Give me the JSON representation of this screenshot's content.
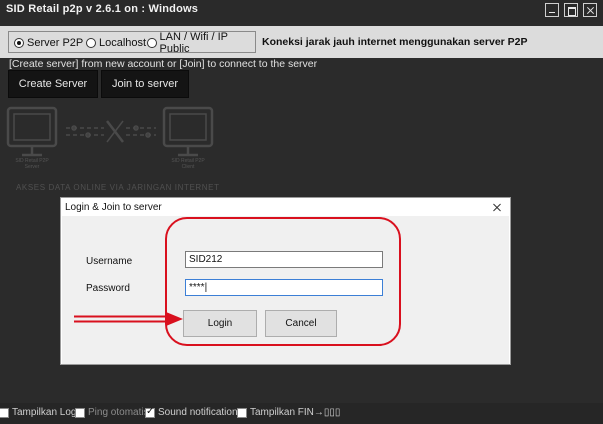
{
  "window": {
    "title": "SID Retail p2p v 2.6.1 on : Windows"
  },
  "mode": {
    "options": [
      "Server P2P",
      "Localhost",
      "LAN / Wifi / IP Public"
    ],
    "selected": "Server P2P",
    "description": "Koneksi jarak jauh internet menggunakan server P2P"
  },
  "hint": "[Create server] from new account or [Join] to connect to the server",
  "toolbar": {
    "create_label": "Create Server",
    "join_label": "Join to server"
  },
  "illustration": {
    "server_label_1": "SID Retail P2P",
    "server_label_2": "Server",
    "client_label_1": "SID Retail P2P",
    "client_label_2": "Client",
    "caption": "AKSES DATA ONLINE VIA JARINGAN INTERNET"
  },
  "dialog": {
    "title": "Login & Join to server",
    "username_label": "Username",
    "username_value": "SID212",
    "password_label": "Password",
    "password_value": "****|",
    "login_label": "Login",
    "cancel_label": "Cancel"
  },
  "statusbar": {
    "items": [
      {
        "label": "Tampilkan Log",
        "checked": false
      },
      {
        "label": "Ping otomatis",
        "checked": false
      },
      {
        "label": "Sound notification",
        "checked": true
      },
      {
        "label": "Tampilkan FIN→",
        "checked": false
      }
    ],
    "trailing": "▯▯▯"
  },
  "colors": {
    "background": "#2b2b2b",
    "modebar": "#dcdcdc",
    "highlight": "#d9101e",
    "dark_button": "#141414"
  },
  "icons": [
    "minimize-icon",
    "maximize-icon",
    "close-icon",
    "monitor-icon",
    "disconnected-link-icon",
    "dialog-close-icon",
    "arrow-right-icon"
  ]
}
